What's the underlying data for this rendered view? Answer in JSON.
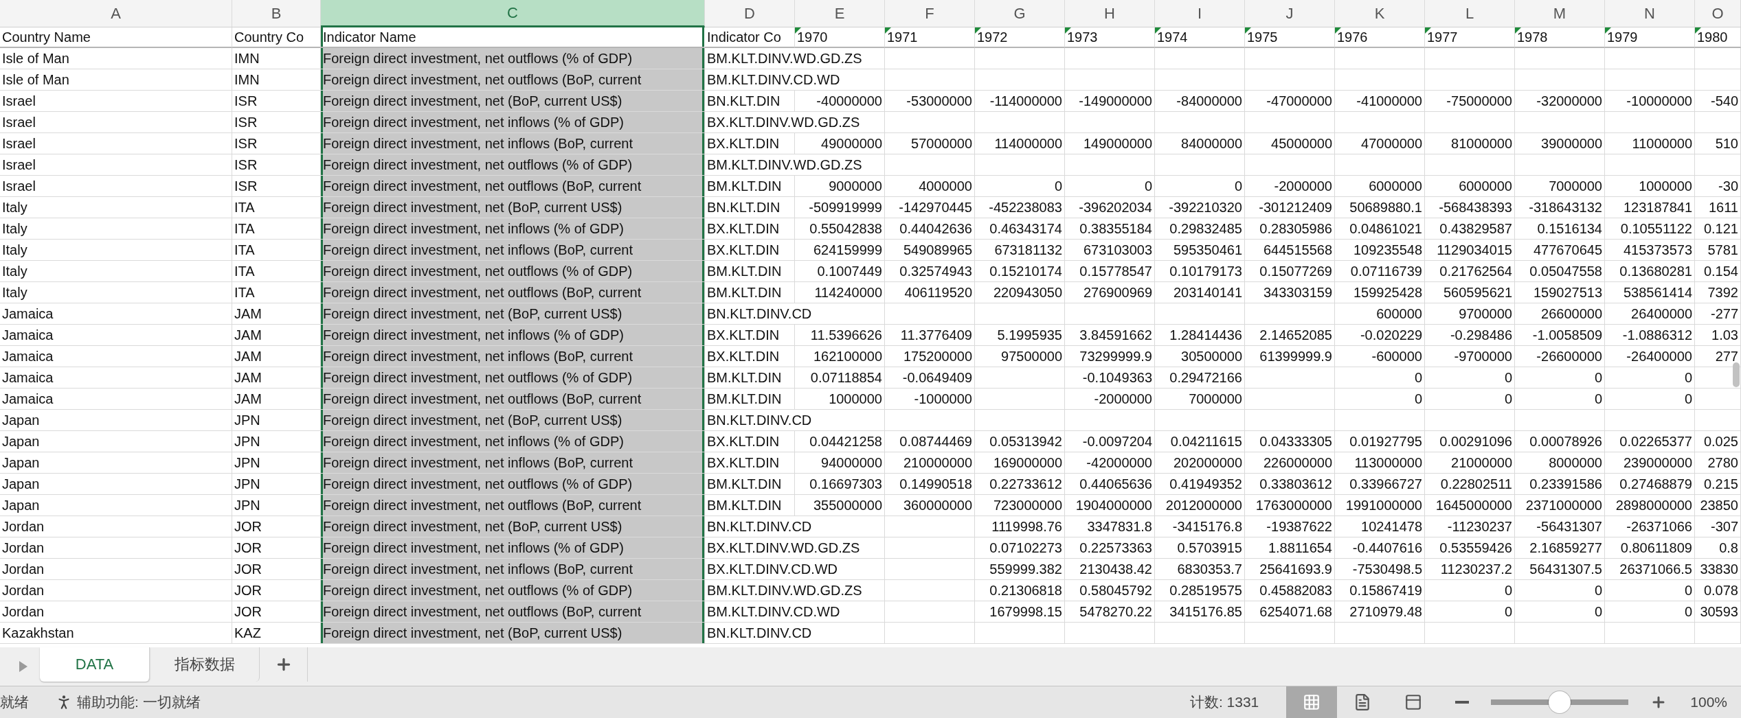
{
  "columns": [
    {
      "letter": "A",
      "selected": false
    },
    {
      "letter": "B",
      "selected": false
    },
    {
      "letter": "C",
      "selected": true
    },
    {
      "letter": "D",
      "selected": false
    },
    {
      "letter": "E",
      "selected": false
    },
    {
      "letter": "F",
      "selected": false
    },
    {
      "letter": "G",
      "selected": false
    },
    {
      "letter": "H",
      "selected": false
    },
    {
      "letter": "I",
      "selected": false
    },
    {
      "letter": "J",
      "selected": false
    },
    {
      "letter": "K",
      "selected": false
    },
    {
      "letter": "L",
      "selected": false
    },
    {
      "letter": "M",
      "selected": false
    },
    {
      "letter": "N",
      "selected": false
    },
    {
      "letter": "O",
      "selected": false
    }
  ],
  "header_row": [
    {
      "text": "Country Name",
      "flag": false
    },
    {
      "text": "Country Co",
      "flag": false
    },
    {
      "text": "Indicator Name",
      "flag": false
    },
    {
      "text": "Indicator Co",
      "flag": false
    },
    {
      "text": "1970",
      "flag": true
    },
    {
      "text": "1971",
      "flag": true
    },
    {
      "text": "1972",
      "flag": true
    },
    {
      "text": "1973",
      "flag": true
    },
    {
      "text": "1974",
      "flag": true
    },
    {
      "text": "1975",
      "flag": true
    },
    {
      "text": "1976",
      "flag": true
    },
    {
      "text": "1977",
      "flag": true
    },
    {
      "text": "1978",
      "flag": true
    },
    {
      "text": "1979",
      "flag": true
    },
    {
      "text": "1980",
      "flag": true
    }
  ],
  "rows": [
    [
      "Isle of Man",
      "IMN",
      "Foreign direct investment, net outflows (% of GDP)",
      "BM.KLT.DINV.WD.GD.ZS",
      "",
      "",
      "",
      "",
      "",
      "",
      "",
      "",
      "",
      "",
      ""
    ],
    [
      "Isle of Man",
      "IMN",
      "Foreign direct investment, net outflows (BoP, current",
      "BM.KLT.DINV.CD.WD",
      "",
      "",
      "",
      "",
      "",
      "",
      "",
      "",
      "",
      "",
      ""
    ],
    [
      "Israel",
      "ISR",
      "Foreign direct investment, net (BoP, current US$)",
      "BN.KLT.DIN",
      "-40000000",
      "-53000000",
      "-114000000",
      "-149000000",
      "-84000000",
      "-47000000",
      "-41000000",
      "-75000000",
      "-32000000",
      "-10000000",
      "-540"
    ],
    [
      "Israel",
      "ISR",
      "Foreign direct investment, net inflows (% of GDP)",
      "BX.KLT.DINV.WD.GD.ZS",
      "",
      "",
      "",
      "",
      "",
      "",
      "",
      "",
      "",
      "",
      ""
    ],
    [
      "Israel",
      "ISR",
      "Foreign direct investment, net inflows (BoP, current",
      "BX.KLT.DIN",
      "49000000",
      "57000000",
      "114000000",
      "149000000",
      "84000000",
      "45000000",
      "47000000",
      "81000000",
      "39000000",
      "11000000",
      "510"
    ],
    [
      "Israel",
      "ISR",
      "Foreign direct investment, net outflows (% of GDP)",
      "BM.KLT.DINV.WD.GD.ZS",
      "",
      "",
      "",
      "",
      "",
      "",
      "",
      "",
      "",
      "",
      ""
    ],
    [
      "Israel",
      "ISR",
      "Foreign direct investment, net outflows (BoP, current",
      "BM.KLT.DIN",
      "9000000",
      "4000000",
      "0",
      "0",
      "0",
      "-2000000",
      "6000000",
      "6000000",
      "7000000",
      "1000000",
      "-30"
    ],
    [
      "Italy",
      "ITA",
      "Foreign direct investment, net (BoP, current US$)",
      "BN.KLT.DIN",
      "-509919999",
      "-142970445",
      "-452238083",
      "-396202034",
      "-392210320",
      "-301212409",
      "50689880.1",
      "-568438393",
      "-318643132",
      "123187841",
      "1611"
    ],
    [
      "Italy",
      "ITA",
      "Foreign direct investment, net inflows (% of GDP)",
      "BX.KLT.DIN",
      "0.55042838",
      "0.44042636",
      "0.46343174",
      "0.38355184",
      "0.29832485",
      "0.28305986",
      "0.04861021",
      "0.43829587",
      "0.1516134",
      "0.10551122",
      "0.121"
    ],
    [
      "Italy",
      "ITA",
      "Foreign direct investment, net inflows (BoP, current",
      "BX.KLT.DIN",
      "624159999",
      "549089965",
      "673181132",
      "673103003",
      "595350461",
      "644515568",
      "109235548",
      "1129034015",
      "477670645",
      "415373573",
      "5781"
    ],
    [
      "Italy",
      "ITA",
      "Foreign direct investment, net outflows (% of GDP)",
      "BM.KLT.DIN",
      "0.1007449",
      "0.32574943",
      "0.15210174",
      "0.15778547",
      "0.10179173",
      "0.15077269",
      "0.07116739",
      "0.21762564",
      "0.05047558",
      "0.13680281",
      "0.154"
    ],
    [
      "Italy",
      "ITA",
      "Foreign direct investment, net outflows (BoP, current",
      "BM.KLT.DIN",
      "114240000",
      "406119520",
      "220943050",
      "276900969",
      "203140141",
      "343303159",
      "159925428",
      "560595621",
      "159027513",
      "538561414",
      "7392"
    ],
    [
      "Jamaica",
      "JAM",
      "Foreign direct investment, net (BoP, current US$)",
      "BN.KLT.DINV.CD",
      "",
      "",
      "",
      "",
      "",
      "",
      "600000",
      "9700000",
      "26600000",
      "26400000",
      "-277"
    ],
    [
      "Jamaica",
      "JAM",
      "Foreign direct investment, net inflows (% of GDP)",
      "BX.KLT.DIN",
      "11.5396626",
      "11.3776409",
      "5.1995935",
      "3.84591662",
      "1.28414436",
      "2.14652085",
      "-0.020229",
      "-0.298486",
      "-1.0058509",
      "-1.0886312",
      "1.03"
    ],
    [
      "Jamaica",
      "JAM",
      "Foreign direct investment, net inflows (BoP, current",
      "BX.KLT.DIN",
      "162100000",
      "175200000",
      "97500000",
      "73299999.9",
      "30500000",
      "61399999.9",
      "-600000",
      "-9700000",
      "-26600000",
      "-26400000",
      "277"
    ],
    [
      "Jamaica",
      "JAM",
      "Foreign direct investment, net outflows (% of GDP)",
      "BM.KLT.DIN",
      "0.07118854",
      "-0.0649409",
      "",
      "-0.1049363",
      "0.29472166",
      "",
      "0",
      "0",
      "0",
      "0",
      ""
    ],
    [
      "Jamaica",
      "JAM",
      "Foreign direct investment, net outflows (BoP, current",
      "BM.KLT.DIN",
      "1000000",
      "-1000000",
      "",
      "-2000000",
      "7000000",
      "",
      "0",
      "0",
      "0",
      "0",
      ""
    ],
    [
      "Japan",
      "JPN",
      "Foreign direct investment, net (BoP, current US$)",
      "BN.KLT.DINV.CD",
      "",
      "",
      "",
      "",
      "",
      "",
      "",
      "",
      "",
      "",
      ""
    ],
    [
      "Japan",
      "JPN",
      "Foreign direct investment, net inflows (% of GDP)",
      "BX.KLT.DIN",
      "0.04421258",
      "0.08744469",
      "0.05313942",
      "-0.0097204",
      "0.04211615",
      "0.04333305",
      "0.01927795",
      "0.00291096",
      "0.00078926",
      "0.02265377",
      "0.025"
    ],
    [
      "Japan",
      "JPN",
      "Foreign direct investment, net inflows (BoP, current",
      "BX.KLT.DIN",
      "94000000",
      "210000000",
      "169000000",
      "-42000000",
      "202000000",
      "226000000",
      "113000000",
      "21000000",
      "8000000",
      "239000000",
      "2780"
    ],
    [
      "Japan",
      "JPN",
      "Foreign direct investment, net outflows (% of GDP)",
      "BM.KLT.DIN",
      "0.16697303",
      "0.14990518",
      "0.22733612",
      "0.44065636",
      "0.41949352",
      "0.33803612",
      "0.33966727",
      "0.22802511",
      "0.23391586",
      "0.27468879",
      "0.215"
    ],
    [
      "Japan",
      "JPN",
      "Foreign direct investment, net outflows (BoP, current",
      "BM.KLT.DIN",
      "355000000",
      "360000000",
      "723000000",
      "1904000000",
      "2012000000",
      "1763000000",
      "1991000000",
      "1645000000",
      "2371000000",
      "2898000000",
      "23850"
    ],
    [
      "Jordan",
      "JOR",
      "Foreign direct investment, net (BoP, current US$)",
      "BN.KLT.DINV.CD",
      "",
      "",
      "1119998.76",
      "3347831.8",
      "-3415176.8",
      "-19387622",
      "10241478",
      "-11230237",
      "-56431307",
      "-26371066",
      "-307"
    ],
    [
      "Jordan",
      "JOR",
      "Foreign direct investment, net inflows (% of GDP)",
      "BX.KLT.DINV.WD.GD.ZS",
      "",
      "",
      "0.07102273",
      "0.22573363",
      "0.5703915",
      "1.8811654",
      "-0.4407616",
      "0.53559426",
      "2.16859277",
      "0.80611809",
      "0.8"
    ],
    [
      "Jordan",
      "JOR",
      "Foreign direct investment, net inflows (BoP, current",
      "BX.KLT.DINV.CD.WD",
      "",
      "",
      "559999.382",
      "2130438.42",
      "6830353.7",
      "25641693.9",
      "-7530498.5",
      "11230237.2",
      "56431307.5",
      "26371066.5",
      "33830"
    ],
    [
      "Jordan",
      "JOR",
      "Foreign direct investment, net outflows (% of GDP)",
      "BM.KLT.DINV.WD.GD.ZS",
      "",
      "",
      "0.21306818",
      "0.58045792",
      "0.28519575",
      "0.45882083",
      "0.15867419",
      "0",
      "0",
      "0",
      "0.078"
    ],
    [
      "Jordan",
      "JOR",
      "Foreign direct investment, net outflows (BoP, current",
      "BM.KLT.DINV.CD.WD",
      "",
      "",
      "1679998.15",
      "5478270.22",
      "3415176.85",
      "6254071.68",
      "2710979.48",
      "0",
      "0",
      "0",
      "30593"
    ],
    [
      "Kazakhstan",
      "KAZ",
      "Foreign direct investment, net (BoP, current US$)",
      "BN.KLT.DINV.CD",
      "",
      "",
      "",
      "",
      "",
      "",
      "",
      "",
      "",
      "",
      ""
    ]
  ],
  "sheet_tabs": [
    {
      "label": "DATA",
      "selected": true
    },
    {
      "label": "指标数据",
      "selected": false
    }
  ],
  "status": {
    "ready": "就绪",
    "accessibility": "辅助功能: 一切就绪",
    "count": "计数: 1331",
    "views": [
      {
        "kind": "normal",
        "selected": true
      },
      {
        "kind": "page_layout",
        "selected": false
      },
      {
        "kind": "page_break",
        "selected": false
      }
    ],
    "zoom": {
      "level": 0.5,
      "reading": "100%"
    }
  }
}
